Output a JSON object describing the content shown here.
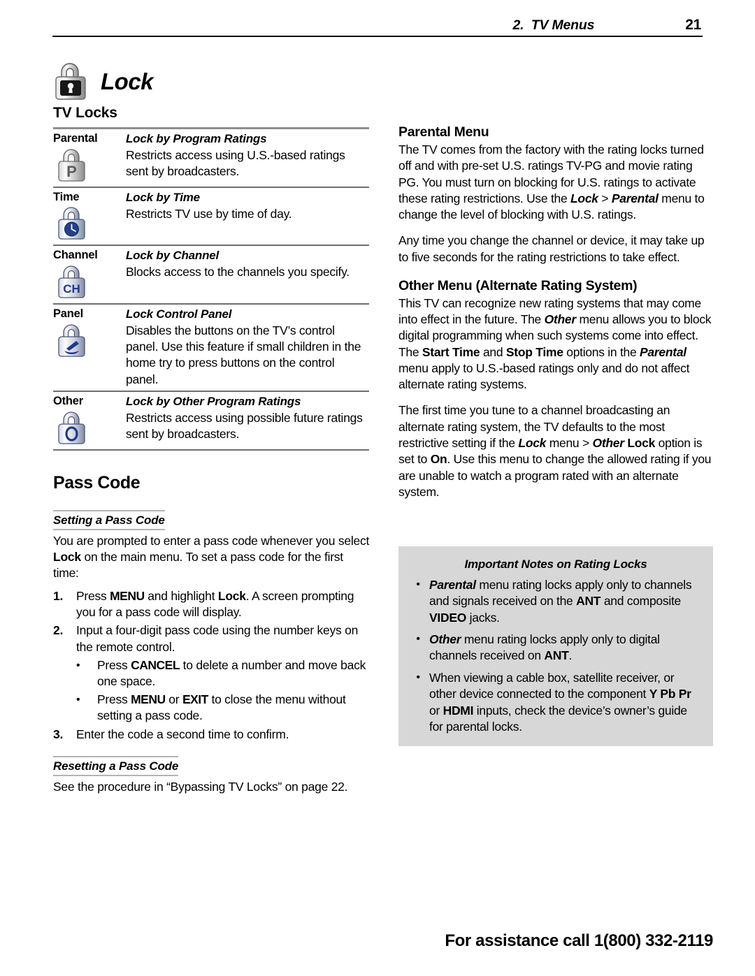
{
  "header": {
    "chapter": "2.  TV Menus",
    "page_number": "21"
  },
  "lock_title": {
    "icon": "padlock-icon",
    "text": "Lock"
  },
  "tv_locks": {
    "section_title": "TV Locks",
    "rows": [
      {
        "name": "Parental",
        "icon": "padlock-p-icon",
        "heading": "Lock by Program Ratings",
        "description": "Restricts access using U.S.-based ratings sent by broadcasters."
      },
      {
        "name": "Time",
        "icon": "padlock-clock-icon",
        "heading": "Lock by Time",
        "description": "Restricts TV use by time of day."
      },
      {
        "name": "Channel",
        "icon": "padlock-ch-icon",
        "heading": "Lock by Channel",
        "description": "Blocks access to the channels you specify."
      },
      {
        "name": "Panel",
        "icon": "padlock-hand-icon",
        "heading": "Lock Control Panel",
        "description": "Disables the buttons on the TV’s control panel.  Use this feature if small children in the home try to press buttons on the control panel."
      },
      {
        "name": "Other",
        "icon": "padlock-o-icon",
        "heading": "Lock by Other Program Ratings",
        "description": "Restricts access using possible future ratings sent by broadcasters."
      }
    ]
  },
  "pass_code": {
    "section_title": "Pass Code",
    "setting_subhead": "Setting a Pass Code",
    "intro_prefix": "You are prompted to enter a pass code whenever you select ",
    "intro_bold": "Lock",
    "intro_suffix": " on the main menu.  To set a pass code for the first time:",
    "steps": [
      {
        "num": "1.",
        "prefix": "Press ",
        "bold1": "MENU",
        "mid": " and highlight ",
        "bold2": "Lock",
        "suffix": ".  A screen prompting you for a pass code will display."
      },
      {
        "num": "2.",
        "prefix": "Input a four-digit pass code using the number keys on the remote control.",
        "bold1": "",
        "mid": "",
        "bold2": "",
        "suffix": ""
      },
      {
        "num": "3.",
        "prefix": "Enter the code a second time to confirm.",
        "bold1": "",
        "mid": "",
        "bold2": "",
        "suffix": ""
      }
    ],
    "sub_bullets": [
      {
        "bullet": "•",
        "prefix": "Press ",
        "bold1": "CANCEL",
        "mid": "",
        "bold2": "",
        "suffix": " to delete a number and move back one space."
      },
      {
        "bullet": "•",
        "prefix": "Press ",
        "bold1": "MENU",
        "mid": " or ",
        "bold2": "EXIT",
        "suffix": " to close the menu without setting a pass code."
      }
    ],
    "resetting_subhead": "Resetting a Pass Code",
    "resetting_text": "See the procedure in “Bypassing TV Locks” on page 22."
  },
  "parental_menu": {
    "title": "Parental Menu",
    "p1_a": "The TV comes from the factory with the rating locks turned off and with pre-set U.S. ratings TV-PG and movie rating PG.  You must turn on blocking for U.S. ratings to activate these rating restrictions.  Use the ",
    "p1_lock": "Lock",
    "p1_gt": " > ",
    "p1_parental": "Parental",
    "p1_b": " menu to change the level of blocking with U.S. ratings.",
    "p2": "Any time you change the channel or device, it may take up to five seconds for the rating restrictions to take effect."
  },
  "other_menu": {
    "title": "Other Menu (Alternate Rating System)",
    "p1_a": "This TV can recognize new rating systems that may come into effect in the future.  The ",
    "p1_other": "Other",
    "p1_b": " menu allows you to block digital programming when such systems come into effect.  The ",
    "p1_start": "Start Time",
    "p1_c": " and ",
    "p1_stop": "Stop Time",
    "p1_d": " options in the ",
    "p1_parental": "Parental",
    "p1_e": " menu apply to U.S.-based ratings only and do not affect alternate rating systems.",
    "p2_a": "The first time you tune to a channel broadcasting an alternate rating system, the TV defaults to the most restrictive setting if the ",
    "p2_lock": "Lock",
    "p2_b": " menu > ",
    "p2_other": "Other",
    "p2_c": " ",
    "p2_lockb": "Lock",
    "p2_d": " option is set to ",
    "p2_on": "On",
    "p2_e": ".  Use this menu to change the allowed rating if you are unable to watch a program rated with an alternate system."
  },
  "notes_box": {
    "title": "Important Notes on Rating Locks",
    "background_color": "#d7d7d7",
    "items": [
      {
        "bullet": "•",
        "a_bi": "Parental",
        "b": " menu rating locks apply only to channels and signals received on the ",
        "c_b": "ANT",
        "d": " and composite ",
        "e_b": "VIDEO",
        "f": " jacks."
      },
      {
        "bullet": "•",
        "a_bi": "Other",
        "b": " menu rating locks apply only to digital channels received on ",
        "c_b": "ANT",
        "d": ".",
        "e_b": "",
        "f": ""
      },
      {
        "bullet": "•",
        "a_bi": "",
        "b": "When viewing a cable box, satellite receiver, or other device connected to the component ",
        "c_b": "Y Pb Pr",
        "d": " or ",
        "e_b": "HDMI",
        "f": " inputs, check the device’s owner’s guide for parental locks."
      }
    ]
  },
  "footer": {
    "text": "For assistance call 1(800) 332-2119"
  }
}
